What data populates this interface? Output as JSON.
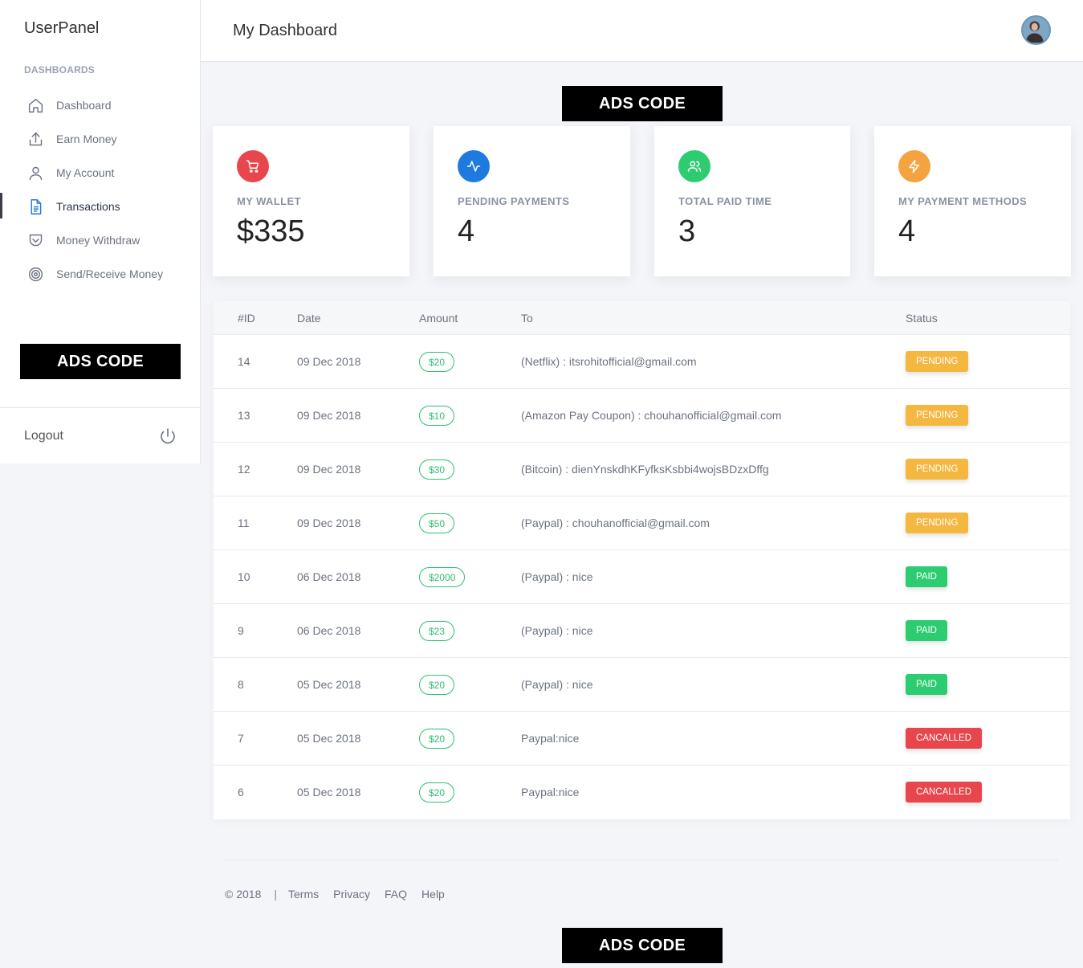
{
  "sidebar": {
    "brand": "UserPanel",
    "section_label": "DASHBOARDS",
    "items": [
      {
        "label": "Dashboard",
        "icon": "home-icon"
      },
      {
        "label": "Earn Money",
        "icon": "upload-icon"
      },
      {
        "label": "My Account",
        "icon": "user-icon"
      },
      {
        "label": "Transactions",
        "icon": "document-icon",
        "active": true
      },
      {
        "label": "Money Withdraw",
        "icon": "pocket-icon"
      },
      {
        "label": "Send/Receive Money",
        "icon": "target-icon"
      }
    ],
    "ads": "ADS CODE",
    "logout": "Logout"
  },
  "header": {
    "title": "My Dashboard"
  },
  "ads_top": "ADS CODE",
  "ads_bottom": "ADS CODE",
  "cards": [
    {
      "label": "MY WALLET",
      "value": "$335",
      "icon": "cart-icon",
      "color": "#e8464c"
    },
    {
      "label": "PENDING PAYMENTS",
      "value": "4",
      "icon": "activity-icon",
      "color": "#1f7ae0"
    },
    {
      "label": "TOTAL PAID TIME",
      "value": "3",
      "icon": "users-icon",
      "color": "#2ecc71"
    },
    {
      "label": "MY PAYMENT METHODS",
      "value": "4",
      "icon": "zap-icon",
      "color": "#f4a340"
    }
  ],
  "table": {
    "headers": {
      "id": "#ID",
      "date": "Date",
      "amount": "Amount",
      "to": "To",
      "status": "Status"
    },
    "rows": [
      {
        "id": "14",
        "date": "09 Dec 2018",
        "amount": "$20",
        "to": "(Netflix) : itsrohitofficial@gmail.com",
        "status": "PENDING",
        "kind": "pending"
      },
      {
        "id": "13",
        "date": "09 Dec 2018",
        "amount": "$10",
        "to": "(Amazon Pay Coupon) : chouhanofficial@gmail.com",
        "status": "PENDING",
        "kind": "pending"
      },
      {
        "id": "12",
        "date": "09 Dec 2018",
        "amount": "$30",
        "to": "(Bitcoin) : dienYnskdhKFyfksKsbbi4wojsBDzxDffg",
        "status": "PENDING",
        "kind": "pending"
      },
      {
        "id": "11",
        "date": "09 Dec 2018",
        "amount": "$50",
        "to": "(Paypal) : chouhanofficial@gmail.com",
        "status": "PENDING",
        "kind": "pending"
      },
      {
        "id": "10",
        "date": "06 Dec 2018",
        "amount": "$2000",
        "to": "(Paypal) : nice",
        "status": "PAID",
        "kind": "paid"
      },
      {
        "id": "9",
        "date": "06 Dec 2018",
        "amount": "$23",
        "to": "(Paypal) : nice",
        "status": "PAID",
        "kind": "paid"
      },
      {
        "id": "8",
        "date": "05 Dec 2018",
        "amount": "$20",
        "to": "(Paypal) : nice",
        "status": "PAID",
        "kind": "paid"
      },
      {
        "id": "7",
        "date": "05 Dec 2018",
        "amount": "$20",
        "to": "Paypal:nice",
        "status": "CANCALLED",
        "kind": "cancelled"
      },
      {
        "id": "6",
        "date": "05 Dec 2018",
        "amount": "$20",
        "to": "Paypal:nice",
        "status": "CANCALLED",
        "kind": "cancelled"
      }
    ]
  },
  "footer": {
    "copyright": "© 2018",
    "separator": "|",
    "links": [
      "Terms",
      "Privacy",
      "FAQ",
      "Help"
    ]
  }
}
